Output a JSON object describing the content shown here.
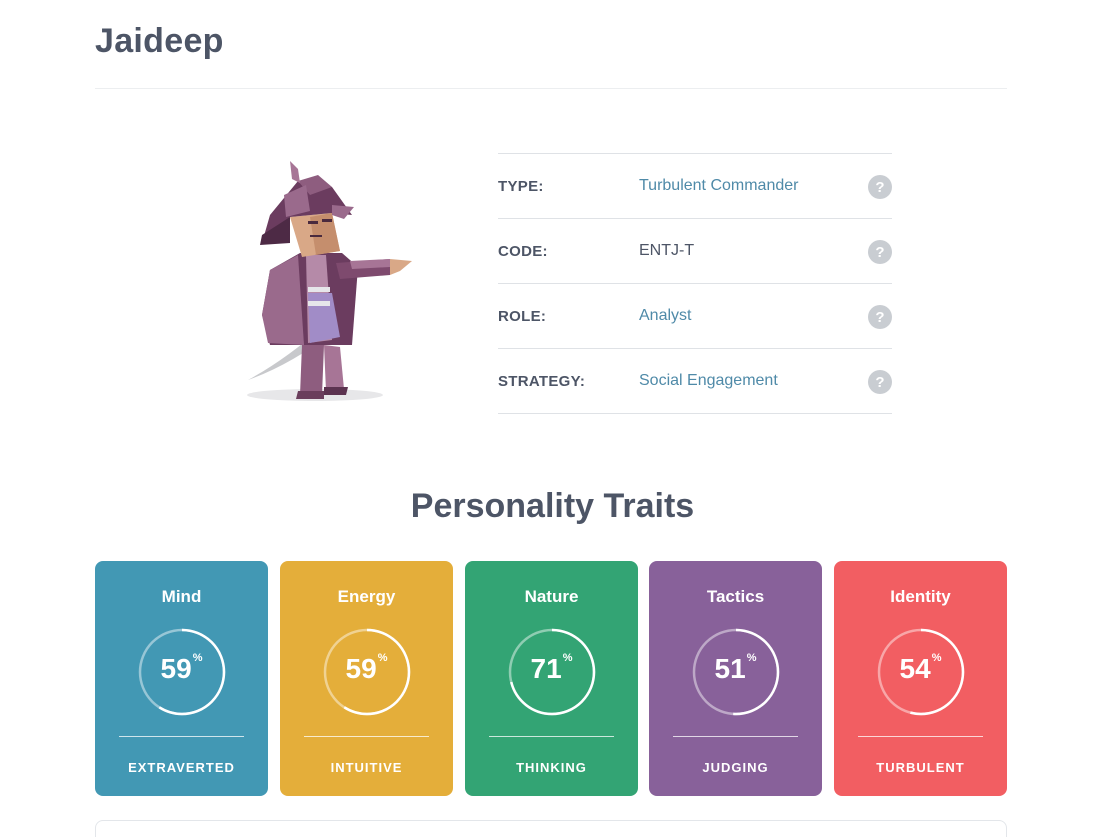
{
  "profile": {
    "name": "Jaideep"
  },
  "info": [
    {
      "key": "TYPE:",
      "value": "Turbulent Commander",
      "link": true
    },
    {
      "key": "CODE:",
      "value": "ENTJ-T",
      "link": false
    },
    {
      "key": "ROLE:",
      "value": "Analyst",
      "link": true
    },
    {
      "key": "STRATEGY:",
      "value": "Social Engagement",
      "link": true
    }
  ],
  "help_glyph": "?",
  "traits_title": "Personality Traits",
  "traits": [
    {
      "name": "Mind",
      "percent": "59",
      "percent_sign": "%",
      "label": "EXTRAVERTED",
      "value": 59,
      "color": "#4298b4"
    },
    {
      "name": "Energy",
      "percent": "59",
      "percent_sign": "%",
      "label": "INTUITIVE",
      "value": 59,
      "color": "#e4ae3a"
    },
    {
      "name": "Nature",
      "percent": "71",
      "percent_sign": "%",
      "label": "THINKING",
      "value": 71,
      "color": "#33a474"
    },
    {
      "name": "Tactics",
      "percent": "51",
      "percent_sign": "%",
      "label": "JUDGING",
      "value": 51,
      "color": "#88619a"
    },
    {
      "name": "Identity",
      "percent": "54",
      "percent_sign": "%",
      "label": "TURBULENT",
      "value": 54,
      "color": "#f25e62"
    }
  ],
  "icons": {
    "help": "question-mark-icon",
    "avatar": "commander-character-illustration"
  }
}
